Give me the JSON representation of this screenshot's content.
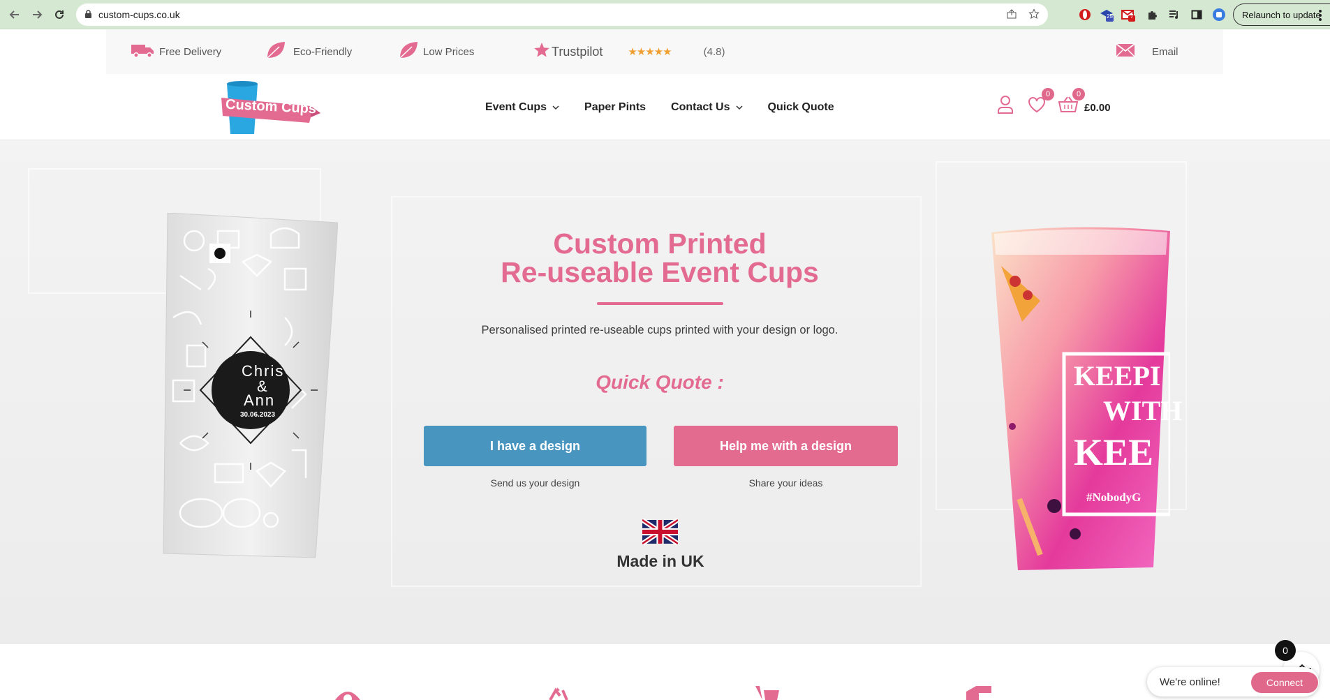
{
  "browser": {
    "url": "custom-cups.co.uk",
    "relaunch_label": "Relaunch to update",
    "ext_badge_1": "25",
    "ext_badge_2": "7"
  },
  "infobar": {
    "items": [
      "Free Delivery",
      "Eco-Friendly",
      "Low Prices"
    ],
    "trustpilot_label": "Trustpilot",
    "rating_value": "(4.8)",
    "email_label": "Email"
  },
  "header": {
    "logo_text": "Custom Cups",
    "nav": [
      "Event Cups",
      "Paper Pints",
      "Contact Us",
      "Quick Quote"
    ],
    "wishlist_count": "0",
    "cart_count": "0",
    "cart_total": "£0.00"
  },
  "hero": {
    "title_line1": "Custom Printed",
    "title_line2": "Re-useable Event Cups",
    "subtitle": "Personalised printed re-useable cups printed with your design or logo.",
    "quick_quote": "Quick Quote :",
    "btn_design": "I have a design",
    "btn_design_sub": "Send us your design",
    "btn_help": "Help me with a design",
    "btn_help_sub": "Share your ideas",
    "made_in": "Made in UK",
    "left_cup_text_1": "Chris",
    "left_cup_text_2": "&",
    "left_cup_text_3": "Ann",
    "left_cup_date": "30.06.2023",
    "right_cup_text_1": "KEEPI",
    "right_cup_text_2": "WITH",
    "right_cup_text_3": "KEE",
    "right_cup_tag": "#NobodyG"
  },
  "chat": {
    "status": "We're online!",
    "connect": "Connect",
    "floating_cart_count": "0"
  },
  "colors": {
    "brand_pink": "#e36b92",
    "brand_blue": "#4896c0"
  }
}
